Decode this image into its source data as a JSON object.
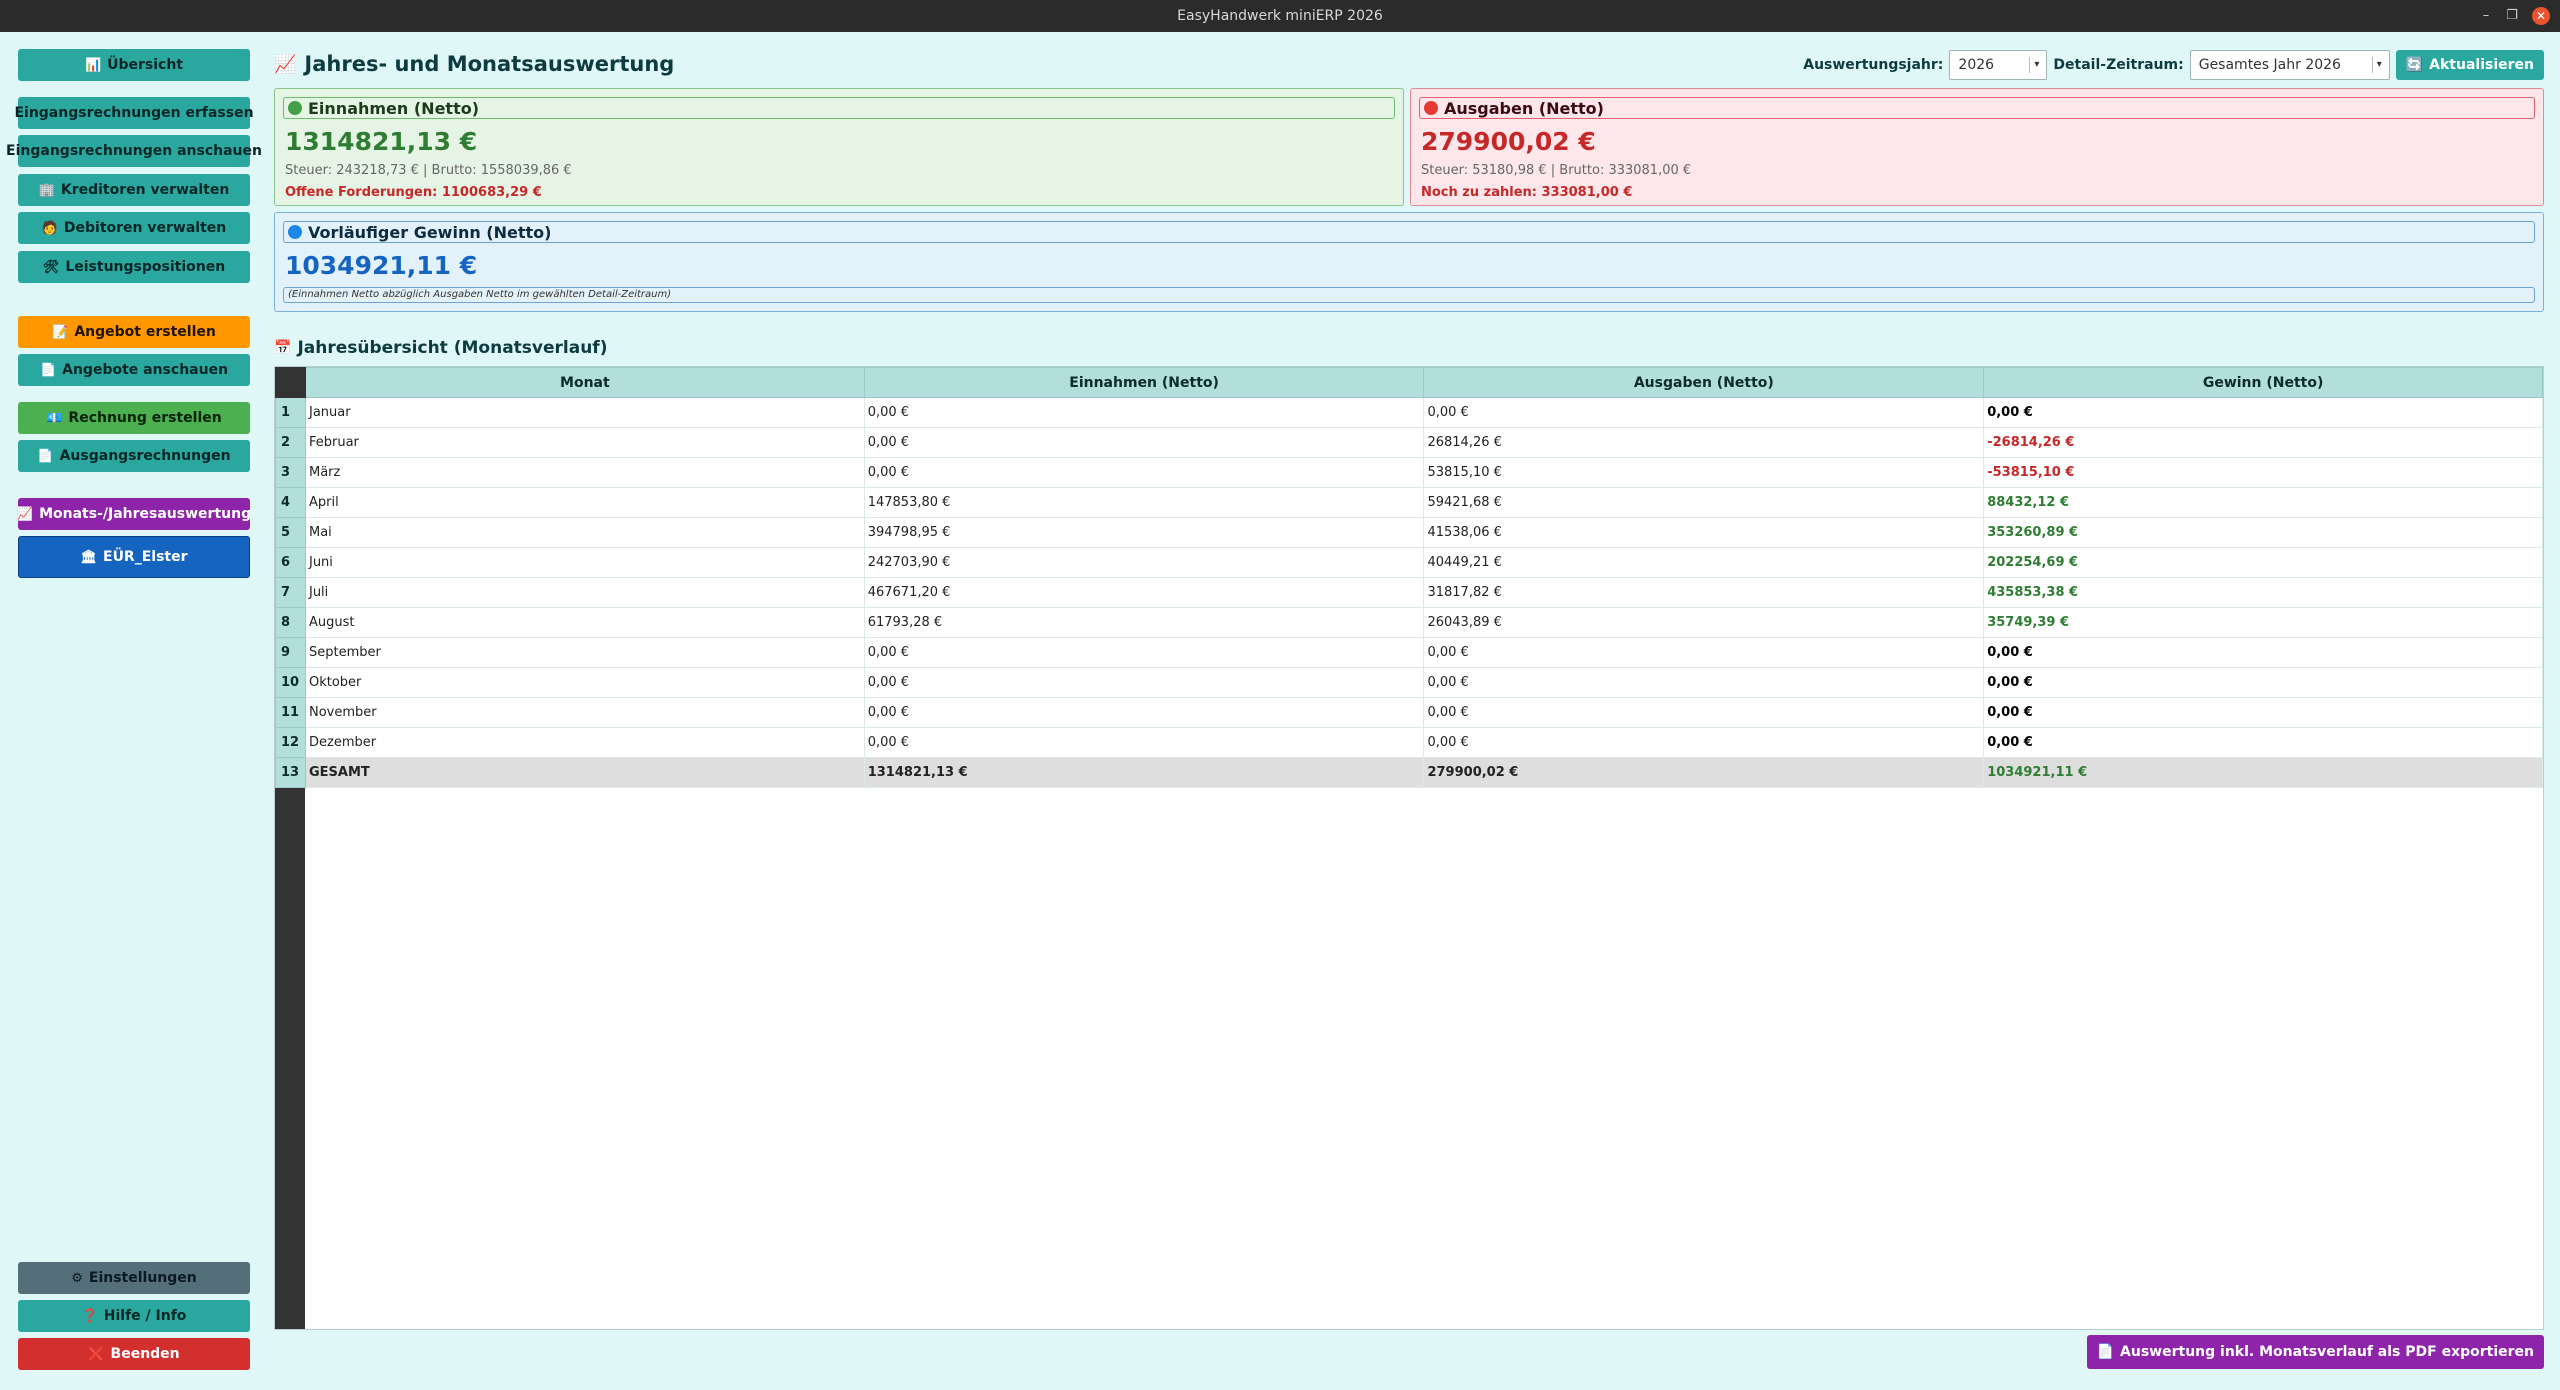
{
  "window": {
    "title": "EasyHandwerk miniERP 2026"
  },
  "sidebar": {
    "overview": "Übersicht",
    "items": [
      {
        "label": "Eingangsrechnungen erfassen"
      },
      {
        "label": "Eingangsrechnungen anschauen"
      },
      {
        "label": "Kreditoren verwalten"
      },
      {
        "label": "Debitoren verwalten"
      },
      {
        "label": "Leistungspositionen"
      },
      {
        "label": "Angebot erstellen"
      },
      {
        "label": "Angebote anschauen"
      },
      {
        "label": "Rechnung erstellen"
      },
      {
        "label": "Ausgangsrechnungen"
      },
      {
        "label": "Monats-/Jahresauswertung"
      },
      {
        "label": "EÜR_Elster"
      }
    ],
    "footer": {
      "settings": "Einstellungen",
      "help": "Hilfe / Info",
      "quit": "Beenden"
    }
  },
  "header": {
    "title": "Jahres- und Monatsauswertung",
    "year_label": "Auswertungsjahr:",
    "year_value": "2026",
    "range_label": "Detail-Zeitraum:",
    "range_value": "Gesamtes Jahr 2026",
    "refresh": "Aktualisieren"
  },
  "cards": {
    "income": {
      "title": "Einnahmen (Netto)",
      "value": "1314821,13 €",
      "sub": "Steuer: 243218,73 € | Brutto: 1558039,86 €",
      "warn": "Offene Forderungen: 1100683,29 €"
    },
    "expense": {
      "title": "Ausgaben (Netto)",
      "value": "279900,02 €",
      "sub": "Steuer: 53180,98 € | Brutto: 333081,00 €",
      "warn": "Noch zu zahlen: 333081,00 €"
    },
    "profit": {
      "title": "Vorläufiger Gewinn (Netto)",
      "value": "1034921,11 €",
      "note": "(Einnahmen Netto abzüglich Ausgaben Netto im gewählten Detail-Zeitraum)"
    }
  },
  "table": {
    "title": "Jahresübersicht (Monatsverlauf)",
    "headers": [
      "Monat",
      "Einnahmen (Netto)",
      "Ausgaben (Netto)",
      "Gewinn (Netto)"
    ],
    "rows": [
      {
        "n": "1",
        "month": "Januar",
        "income": "0,00 €",
        "expense": "0,00 €",
        "profit": "0,00 €",
        "sign": "zero"
      },
      {
        "n": "2",
        "month": "Februar",
        "income": "0,00 €",
        "expense": "26814,26 €",
        "profit": "-26814,26 €",
        "sign": "neg"
      },
      {
        "n": "3",
        "month": "März",
        "income": "0,00 €",
        "expense": "53815,10 €",
        "profit": "-53815,10 €",
        "sign": "neg"
      },
      {
        "n": "4",
        "month": "April",
        "income": "147853,80 €",
        "expense": "59421,68 €",
        "profit": "88432,12 €",
        "sign": "pos"
      },
      {
        "n": "5",
        "month": "Mai",
        "income": "394798,95 €",
        "expense": "41538,06 €",
        "profit": "353260,89 €",
        "sign": "pos"
      },
      {
        "n": "6",
        "month": "Juni",
        "income": "242703,90 €",
        "expense": "40449,21 €",
        "profit": "202254,69 €",
        "sign": "pos"
      },
      {
        "n": "7",
        "month": "Juli",
        "income": "467671,20 €",
        "expense": "31817,82 €",
        "profit": "435853,38 €",
        "sign": "pos"
      },
      {
        "n": "8",
        "month": "August",
        "income": "61793,28 €",
        "expense": "26043,89 €",
        "profit": "35749,39 €",
        "sign": "pos"
      },
      {
        "n": "9",
        "month": "September",
        "income": "0,00 €",
        "expense": "0,00 €",
        "profit": "0,00 €",
        "sign": "zero"
      },
      {
        "n": "10",
        "month": "Oktober",
        "income": "0,00 €",
        "expense": "0,00 €",
        "profit": "0,00 €",
        "sign": "zero"
      },
      {
        "n": "11",
        "month": "November",
        "income": "0,00 €",
        "expense": "0,00 €",
        "profit": "0,00 €",
        "sign": "zero"
      },
      {
        "n": "12",
        "month": "Dezember",
        "income": "0,00 €",
        "expense": "0,00 €",
        "profit": "0,00 €",
        "sign": "zero"
      },
      {
        "n": "13",
        "month": "GESAMT",
        "income": "1314821,13 €",
        "expense": "279900,02 €",
        "profit": "1034921,11 €",
        "sign": "pos"
      }
    ]
  },
  "export": {
    "label": "Auswertung inkl. Monatsverlauf als PDF exportieren"
  },
  "colors": {
    "teal": "#2aa89f",
    "orange": "#ff9800",
    "green": "#4caf50",
    "purple": "#8e24aa",
    "blue": "#1565c0",
    "grey": "#546e7a",
    "red": "#d32f2f",
    "positive": "#2e7d32",
    "negative": "#c62828"
  }
}
